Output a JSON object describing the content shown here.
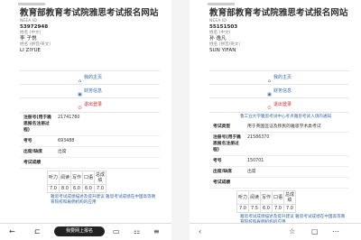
{
  "left": {
    "header": {
      "title": "教育部教育考试院雅思考试报名网站",
      "neea_id_label": "NEEA ID",
      "neea_id": "53972948",
      "cn_name_label": "姓名 (中文)",
      "cn_name": "李 子悦",
      "py_name_label": "姓名 (拼音/英文)",
      "py_name": "LI ZIYUE"
    },
    "menu": [
      "我的主页",
      "财务信息",
      "退出登录"
    ],
    "fields": [
      {
        "k": "注册号(用于雅思报名注册过程)",
        "v": "21741780"
      },
      {
        "k": "考号",
        "v": "693488"
      },
      {
        "k": "出席/缺席",
        "v": "出席"
      },
      {
        "k": "考试成绩",
        "v": ""
      }
    ],
    "scores": {
      "headers": [
        "听力",
        "阅读",
        "写作",
        "口语",
        "总成绩"
      ],
      "values": [
        "7.0",
        "8.0",
        "6.0",
        "6.0",
        "7.0"
      ]
    },
    "link": "雅思考试成绩描述及提升建议 雅思考试成绩在中国高等教育院校和雇佣机构的应用",
    "bottom_pill": "我要网上报名"
  },
  "right": {
    "header": {
      "title": "教育部教育考试院雅思考试报名网站",
      "neea_id_label": "NEEA ID",
      "neea_id": "55151503",
      "cn_name_label": "姓名 (中文)",
      "cn_name": "孙 逸凡",
      "py_name_label": "姓名 (拼音/英文)",
      "py_name": "SUN YIFAN"
    },
    "menu": [
      "我的主页",
      "财务信息",
      "退出登录"
    ],
    "fields": [
      {
        "k": "考试类型",
        "v": "用于英国签证及移民的雅思学术类考试"
      },
      {
        "k": "注册号(用于雅思报名注册过程)",
        "v": "21586370"
      },
      {
        "k": "考号",
        "v": "150701"
      },
      {
        "k": "出席/缺席",
        "v": "出席"
      },
      {
        "k": "考试成绩",
        "v": ""
      }
    ],
    "top_link": "鲁工业大学雅思考试中心考点雅思考试入场的通知",
    "scores": {
      "headers": [
        "听力",
        "阅读",
        "写作",
        "口语",
        "总成绩"
      ],
      "values": [
        "7.0",
        "7.5",
        "6.0",
        "7.0",
        "7.0"
      ]
    },
    "link": "雅思考试成绩描述及提升建议 雅思考试成绩在中国高等教育院校和雇佣机构的应用"
  }
}
